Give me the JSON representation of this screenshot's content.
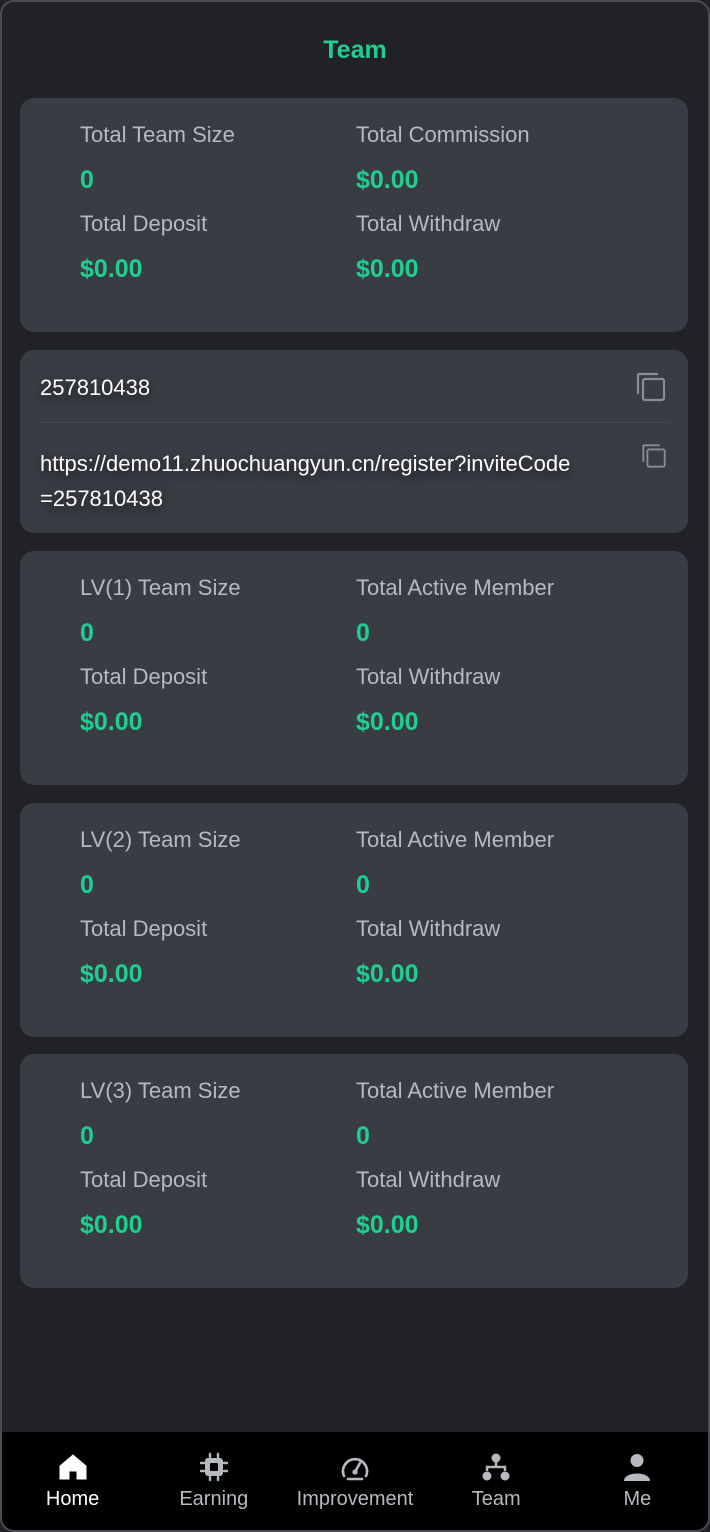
{
  "header": {
    "title": "Team"
  },
  "summary": {
    "total_team_size_label": "Total Team Size",
    "total_team_size": "0",
    "total_commission_label": "Total Commission",
    "total_commission": "$0.00",
    "total_deposit_label": "Total Deposit",
    "total_deposit": "$0.00",
    "total_withdraw_label": "Total Withdraw",
    "total_withdraw": "$0.00"
  },
  "invite": {
    "code": "257810438",
    "link": "https://demo11.zhuochuangyun.cn/register?inviteCode=257810438"
  },
  "levels": [
    {
      "team_size_label": "LV(1) Team Size",
      "team_size": "0",
      "active_label": "Total Active Member",
      "active": "0",
      "deposit_label": "Total Deposit",
      "deposit": "$0.00",
      "withdraw_label": "Total Withdraw",
      "withdraw": "$0.00"
    },
    {
      "team_size_label": "LV(2) Team Size",
      "team_size": "0",
      "active_label": "Total Active Member",
      "active": "0",
      "deposit_label": "Total Deposit",
      "deposit": "$0.00",
      "withdraw_label": "Total Withdraw",
      "withdraw": "$0.00"
    },
    {
      "team_size_label": "LV(3) Team Size",
      "team_size": "0",
      "active_label": "Total Active Member",
      "active": "0",
      "deposit_label": "Total Deposit",
      "deposit": "$0.00",
      "withdraw_label": "Total Withdraw",
      "withdraw": "$0.00"
    }
  ],
  "tabbar": {
    "items": [
      {
        "label": "Home",
        "icon": "home-icon",
        "active": true
      },
      {
        "label": "Earning",
        "icon": "chip-icon",
        "active": false
      },
      {
        "label": "Improvement",
        "icon": "gauge-icon",
        "active": false
      },
      {
        "label": "Team",
        "icon": "hierarchy-icon",
        "active": false
      },
      {
        "label": "Me",
        "icon": "user-icon",
        "active": false
      }
    ]
  },
  "colors": {
    "accent": "#1fcf8f",
    "background": "#202227",
    "card": "#393c43",
    "label": "#b6b9bf",
    "tabbar": "#000000"
  }
}
